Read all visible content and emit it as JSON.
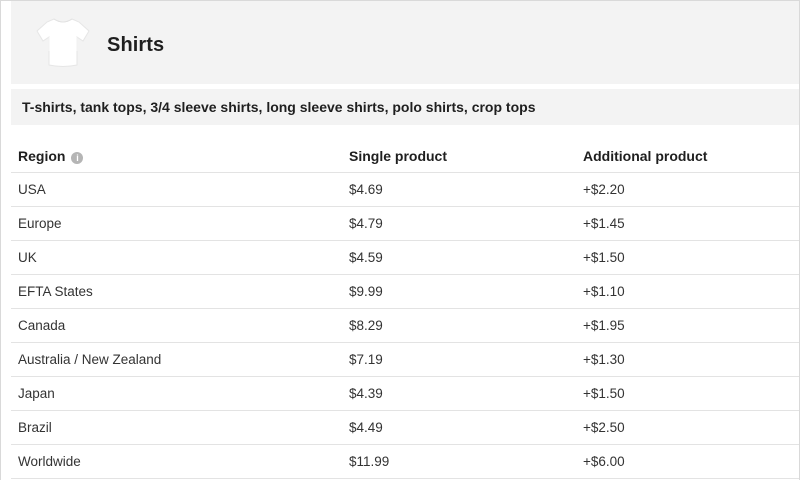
{
  "header": {
    "title": "Shirts",
    "product_icon": "t-shirt-icon"
  },
  "subheader": {
    "text": "T-shirts, tank tops, 3/4 sleeve shirts, long sleeve shirts, polo shirts, crop tops"
  },
  "table": {
    "columns": {
      "region": "Region",
      "single": "Single product",
      "additional": "Additional product"
    },
    "info_icon_glyph": "i",
    "rows": [
      {
        "region": "USA",
        "single": "$4.69",
        "additional": "+$2.20"
      },
      {
        "region": "Europe",
        "single": "$4.79",
        "additional": "+$1.45"
      },
      {
        "region": "UK",
        "single": "$4.59",
        "additional": "+$1.50"
      },
      {
        "region": "EFTA States",
        "single": "$9.99",
        "additional": "+$1.10"
      },
      {
        "region": "Canada",
        "single": "$8.29",
        "additional": "+$1.95"
      },
      {
        "region": "Australia / New Zealand",
        "single": "$7.19",
        "additional": "+$1.30"
      },
      {
        "region": "Japan",
        "single": "$4.39",
        "additional": "+$1.50"
      },
      {
        "region": "Brazil",
        "single": "$4.49",
        "additional": "+$2.50"
      },
      {
        "region": "Worldwide",
        "single": "$11.99",
        "additional": "+$6.00"
      }
    ]
  },
  "colors": {
    "header_bg": "#f3f3f3",
    "border": "#e3e3e3",
    "text": "#222222",
    "info_icon": "#b5b5b5"
  }
}
